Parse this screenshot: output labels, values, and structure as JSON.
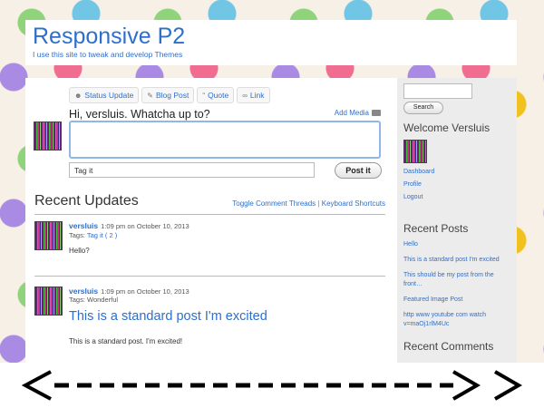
{
  "site": {
    "title": "Responsive P2",
    "description": "I use this site to tweak and develop Themes"
  },
  "post_tabs": [
    {
      "label": "Status Update",
      "icon": "person-icon"
    },
    {
      "label": "Blog Post",
      "icon": "pin-icon"
    },
    {
      "label": "Quote",
      "icon": "quote-icon"
    },
    {
      "label": "Link",
      "icon": "link-icon"
    }
  ],
  "composer": {
    "prompt": "Hi, versluis. Whatcha up to?",
    "add_media": "Add Media",
    "tag_placeholder": "Tag it",
    "post_button": "Post it"
  },
  "recent": {
    "title": "Recent Updates",
    "toggle": "Toggle Comment Threads",
    "separator": "|",
    "shortcuts": "Keyboard Shortcuts"
  },
  "updates": [
    {
      "author": "versluis",
      "meta": "1:09 pm on October 10, 2013",
      "tags_label": "Tags:",
      "tags": "Tag it ( 2 )",
      "text": "Hello?"
    },
    {
      "author": "versluis",
      "meta": "1:09 pm on October 10, 2013",
      "tags_label": "Tags: Wonderful",
      "title": "This is a standard post I'm excited",
      "text": "This is a standard post. I'm excited!"
    }
  ],
  "sidebar": {
    "search_button": "Search",
    "welcome": "Welcome Versluis",
    "user_links": [
      "Dashboard",
      "Profile",
      "Logout"
    ],
    "recent_posts_title": "Recent Posts",
    "recent_posts": [
      "Hello",
      "This is a standard post I'm excited",
      "This should be my post from the front…",
      "Featured Image Post",
      "http www youtube com watch v=maOj1rlM4Uc"
    ],
    "recent_comments_title": "Recent Comments"
  },
  "colors": {
    "link": "#2e6fcc",
    "background_dots": [
      "#f06c91",
      "#f1c21f",
      "#a98be3",
      "#71c6e6",
      "#8fd37a"
    ]
  }
}
